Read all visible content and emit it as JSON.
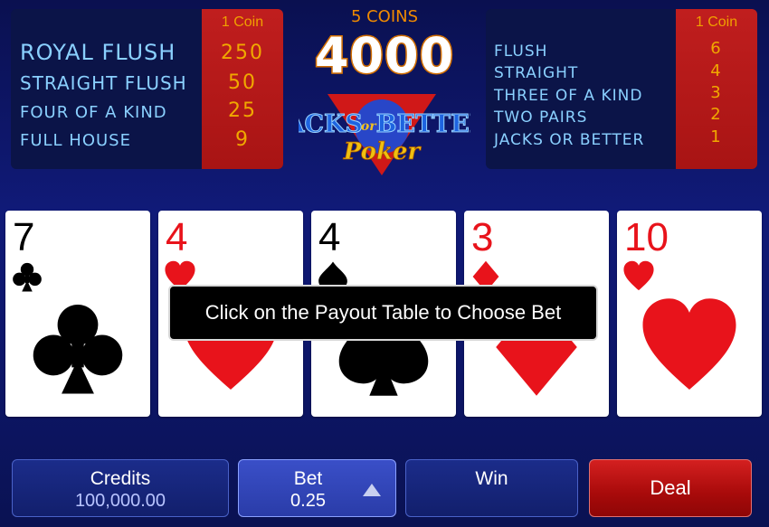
{
  "paytable_left": {
    "coin_header": "1 Coin",
    "hands": [
      {
        "name": "ROYAL FLUSH",
        "pay": "250"
      },
      {
        "name": "STRAIGHT FLUSH",
        "pay": "50"
      },
      {
        "name": "FOUR OF A KIND",
        "pay": "25"
      },
      {
        "name": "FULL HOUSE",
        "pay": "9"
      }
    ]
  },
  "paytable_right": {
    "coin_header": "1 Coin",
    "hands": [
      {
        "name": "FLUSH",
        "pay": "6"
      },
      {
        "name": "STRAIGHT",
        "pay": "4"
      },
      {
        "name": "THREE OF A KIND",
        "pay": "3"
      },
      {
        "name": "TWO PAIRS",
        "pay": "2"
      },
      {
        "name": "JACKS OR BETTER",
        "pay": "1"
      }
    ]
  },
  "jackpot": {
    "coins_label": "5 COINS",
    "amount": "4000"
  },
  "logo": {
    "word1": "JACKS",
    "word2": "or",
    "word3": "BETTER",
    "word4": "Poker"
  },
  "cards": [
    {
      "rank": "7",
      "suit": "club-icon",
      "color": "#000000"
    },
    {
      "rank": "4",
      "suit": "heart-icon",
      "color": "#e8131b"
    },
    {
      "rank": "4",
      "suit": "spade-icon",
      "color": "#000000"
    },
    {
      "rank": "3",
      "suit": "diamond-icon",
      "color": "#e8131b"
    },
    {
      "rank": "10",
      "suit": "heart-icon",
      "color": "#e8131b"
    }
  ],
  "message": "Click on the Payout Table to Choose Bet",
  "bottom": {
    "credits_label": "Credits",
    "credits_value": "100,000.00",
    "bet_label": "Bet",
    "bet_value": "0.25",
    "win_label": "Win",
    "deal_label": "Deal"
  },
  "colors": {
    "accent_red": "#c01e1e",
    "gold": "#f0a800",
    "hand_text": "#8ad0ff",
    "background": "#101a78"
  }
}
